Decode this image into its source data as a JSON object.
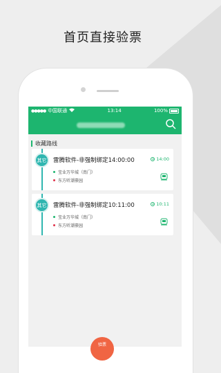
{
  "headline": "首页直接验票",
  "status_bar": {
    "carrier": "中国联通",
    "time": "13:14",
    "battery": "100%"
  },
  "section": {
    "title": "收藏路线"
  },
  "routes": [
    {
      "badge": "其它",
      "title": "雷腾软件-非强制绑定14:00:00",
      "time": "14:00",
      "from": "宝业万华城（南门）",
      "to": "东方听潮豪园"
    },
    {
      "badge": "其它",
      "title": "雷腾软件-非强制绑定10:11:00",
      "time": "10:11",
      "from": "宝业万华城（南门）",
      "to": "东方听潮豪园"
    }
  ],
  "fab": {
    "label": "验票"
  },
  "colors": {
    "primary": "#1db56f",
    "badge": "#2fb6b0",
    "start_dot": "#1db56f",
    "end_dot": "#e0324a",
    "fab": "#f06543"
  }
}
